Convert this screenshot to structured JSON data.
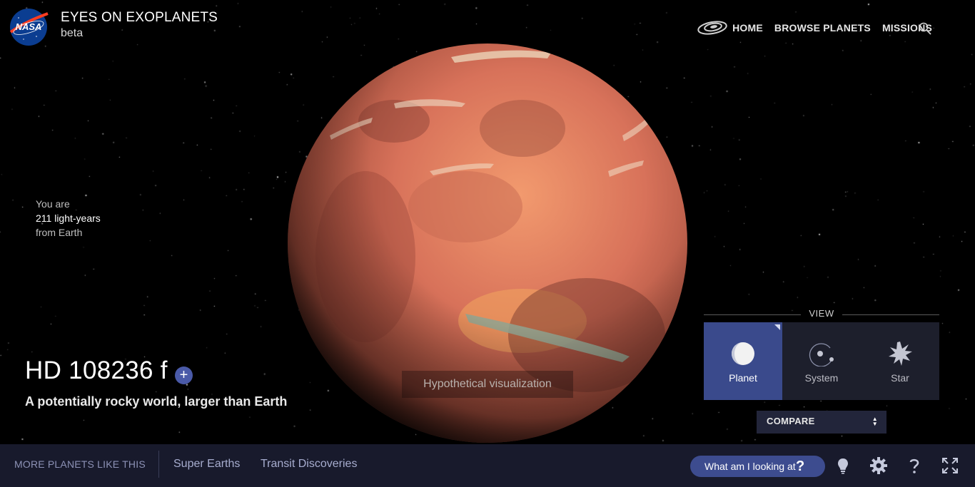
{
  "header": {
    "logo_text": "NASA",
    "title": "EYES ON EXOPLANETS",
    "subtitle": "beta",
    "nav": [
      {
        "label": "HOME",
        "icon": "galaxy-icon"
      },
      {
        "label": "BROWSE PLANETS"
      },
      {
        "label": "MISSIONS"
      }
    ],
    "search_icon": "search-icon"
  },
  "distance": {
    "prefix": "You are",
    "value": "211 light-years",
    "suffix": "from Earth"
  },
  "planet": {
    "name": "HD 108236 f",
    "add_label": "+",
    "description": "A potentially rocky world, larger than Earth",
    "visual_note": "Hypothetical visualization"
  },
  "view": {
    "label": "VIEW",
    "options": [
      {
        "label": "Planet",
        "icon": "planet-icon",
        "active": true
      },
      {
        "label": "System",
        "icon": "system-icon",
        "active": false
      },
      {
        "label": "Star",
        "icon": "star-icon",
        "active": false
      }
    ]
  },
  "compare": {
    "label": "COMPARE",
    "arrows_up": "▲",
    "arrows_down": "▼"
  },
  "bottom_bar": {
    "more_label": "MORE PLANETS LIKE THIS",
    "links": [
      "Super Earths",
      "Transit Discoveries"
    ],
    "help_button": "What am I looking at",
    "help_mark": "?",
    "icons": [
      "lightbulb-icon",
      "gear-icon",
      "help-icon",
      "fullscreen-icon"
    ]
  },
  "colors": {
    "accent": "#3d4c8f",
    "active_view": "#3a4a8c",
    "bottom_bar": "#181a2c",
    "planet": "#d9705a"
  }
}
